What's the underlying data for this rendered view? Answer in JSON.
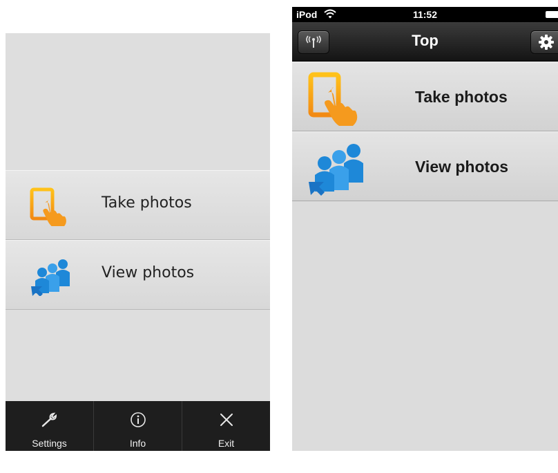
{
  "android": {
    "menu": [
      {
        "label": "Take photos",
        "icon": "take-photos-icon"
      },
      {
        "label": "View photos",
        "icon": "view-photos-icon"
      }
    ],
    "bottom_bar": [
      {
        "label": "Settings",
        "icon": "wrench-icon"
      },
      {
        "label": "Info",
        "icon": "info-icon"
      },
      {
        "label": "Exit",
        "icon": "close-icon"
      }
    ]
  },
  "ios": {
    "status_bar": {
      "carrier": "iPod",
      "time": "11:52"
    },
    "nav_bar": {
      "title": "Top",
      "left_icon": "wireless-icon",
      "right_icon": "gear-icon"
    },
    "menu": [
      {
        "label": "Take photos",
        "icon": "take-photos-icon"
      },
      {
        "label": "View photos",
        "icon": "view-photos-icon"
      }
    ]
  },
  "colors": {
    "orange_accent": "#f59a1e",
    "blue_accent": "#1e88d8",
    "bar_dark": "#1e1e1e"
  }
}
